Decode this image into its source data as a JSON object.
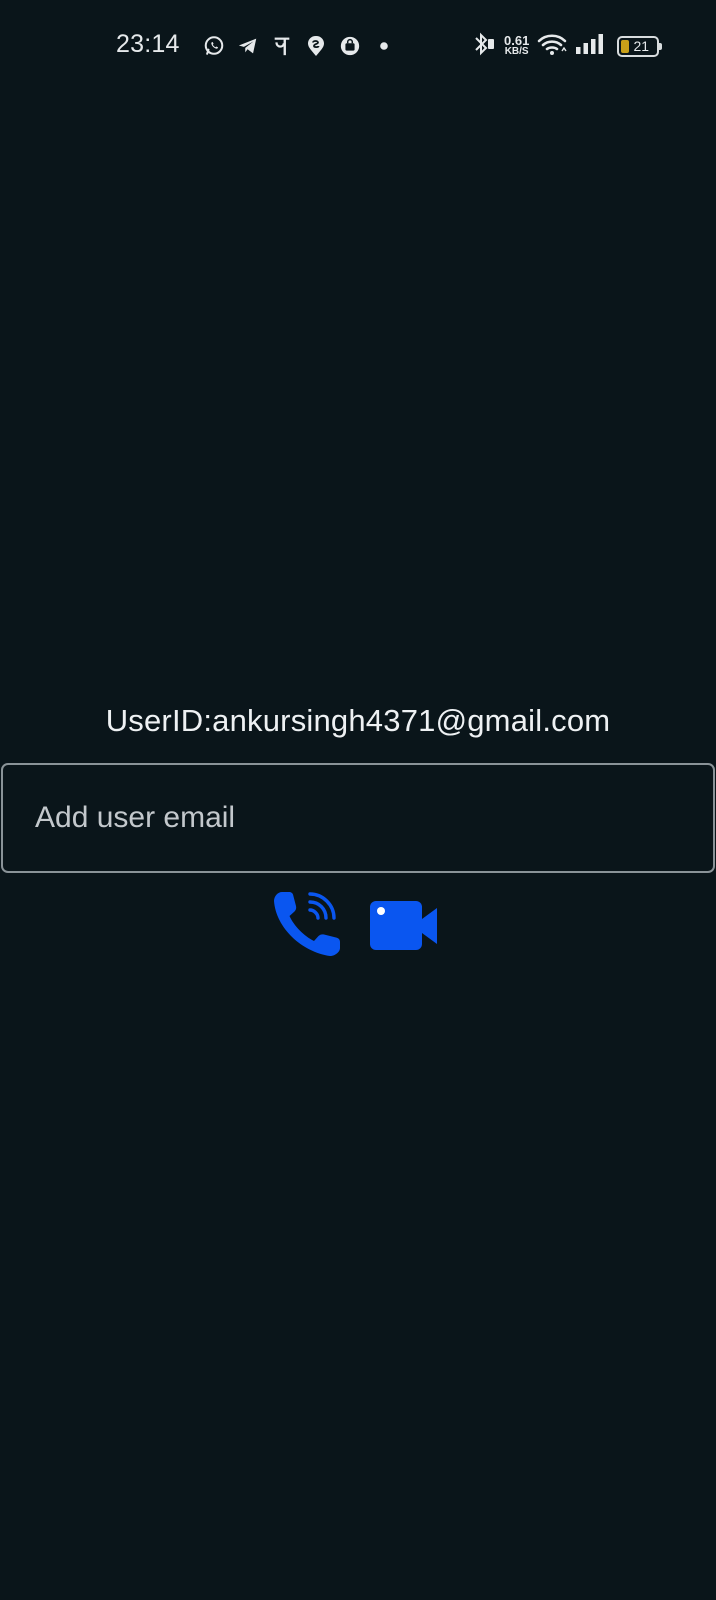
{
  "status_bar": {
    "time": "23:14",
    "net_speed_value": "0.61",
    "net_speed_unit": "KB/S",
    "battery_level": "21",
    "left_icons": [
      "whatsapp-icon",
      "telegram-icon",
      "phonepe-icon",
      "swiggy-icon",
      "shopping-bag-icon",
      "notification-dot-icon"
    ],
    "right_icons": [
      "bluetooth-icon",
      "wifi-icon",
      "signal-icon",
      "battery-icon"
    ]
  },
  "main": {
    "user_id_label": "UserID:ankursingh4371@gmail.com",
    "email_input": {
      "value": "",
      "placeholder": "Add user email"
    },
    "actions": [
      {
        "name": "voice-call-button",
        "icon": "phone-call-icon",
        "color": "#0a56f0"
      },
      {
        "name": "video-call-button",
        "icon": "video-camera-icon",
        "color": "#0a56f0"
      }
    ]
  },
  "colors": {
    "background": "#0a151a",
    "accent": "#0a56f0",
    "text": "#eef1f3",
    "border": "#8a9398"
  }
}
